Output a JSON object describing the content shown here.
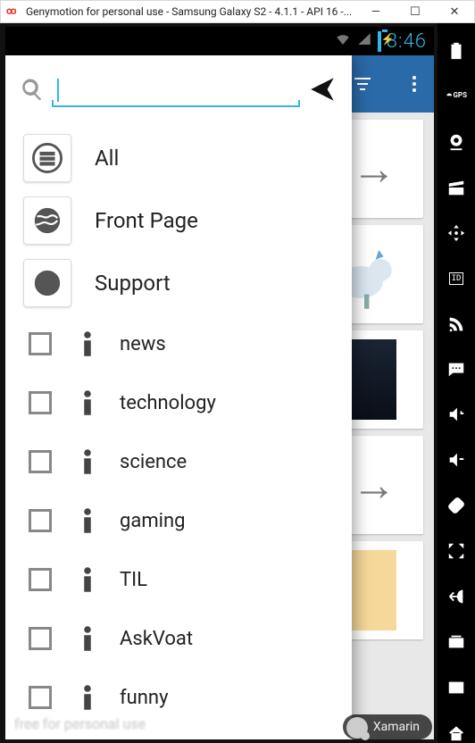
{
  "window": {
    "title": "Genymotion for personal use - Samsung Galaxy S2 - 4.1.1 - API 16 -...",
    "icon_label": "oo"
  },
  "statusbar": {
    "time": "8:46"
  },
  "drawer": {
    "search": {
      "value": "",
      "placeholder": ""
    },
    "top_items": [
      {
        "label": "All",
        "icon": "grid"
      },
      {
        "label": "Front Page",
        "icon": "globe"
      },
      {
        "label": "Support",
        "icon": "wheel"
      }
    ],
    "items": [
      {
        "label": "news",
        "checked": false
      },
      {
        "label": "technology",
        "checked": false
      },
      {
        "label": "science",
        "checked": false
      },
      {
        "label": "gaming",
        "checked": false
      },
      {
        "label": "TIL",
        "checked": false
      },
      {
        "label": "AskVoat",
        "checked": false
      },
      {
        "label": "funny",
        "checked": false
      }
    ]
  },
  "emu_rail": [
    "battery",
    "gps",
    "webcam",
    "clapper",
    "dpad",
    "id",
    "rss",
    "sms",
    "vol-up",
    "vol-down",
    "rotate",
    "fullscreen",
    "back",
    "recent",
    "multiwin",
    "home"
  ],
  "watermark": "free for personal use",
  "badge": "Xamarin"
}
